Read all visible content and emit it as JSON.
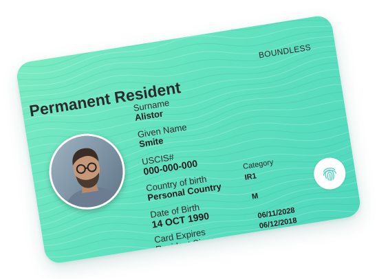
{
  "card": {
    "brand": "BOUNDLESS",
    "title": "Permanent Resident",
    "fields": {
      "surname": {
        "label": "Surname",
        "value": "Alistor"
      },
      "given_name": {
        "label": "Given Name",
        "value": "Smite"
      },
      "uscis": {
        "label": "USCIS#",
        "value": "000-000-000"
      },
      "country": {
        "label": "Country of birth",
        "value": "Personal Country"
      },
      "category": {
        "label": "Category",
        "value": "IR1"
      },
      "dob": {
        "label": "Date of Birth",
        "value": "14 OCT 1990"
      },
      "sex": {
        "value": "M"
      },
      "expires": {
        "label": "Card Expires",
        "value": "06/11/2028"
      },
      "resident_since": {
        "label": "Resident Since",
        "value": "06/12/2018"
      }
    },
    "icons": {
      "photo": "resident-photo",
      "fingerprint": "fingerprint-icon"
    },
    "colors": {
      "card_start": "#7cebc3",
      "card_end": "#4fd7bd",
      "text": "#1e1e1e"
    }
  }
}
